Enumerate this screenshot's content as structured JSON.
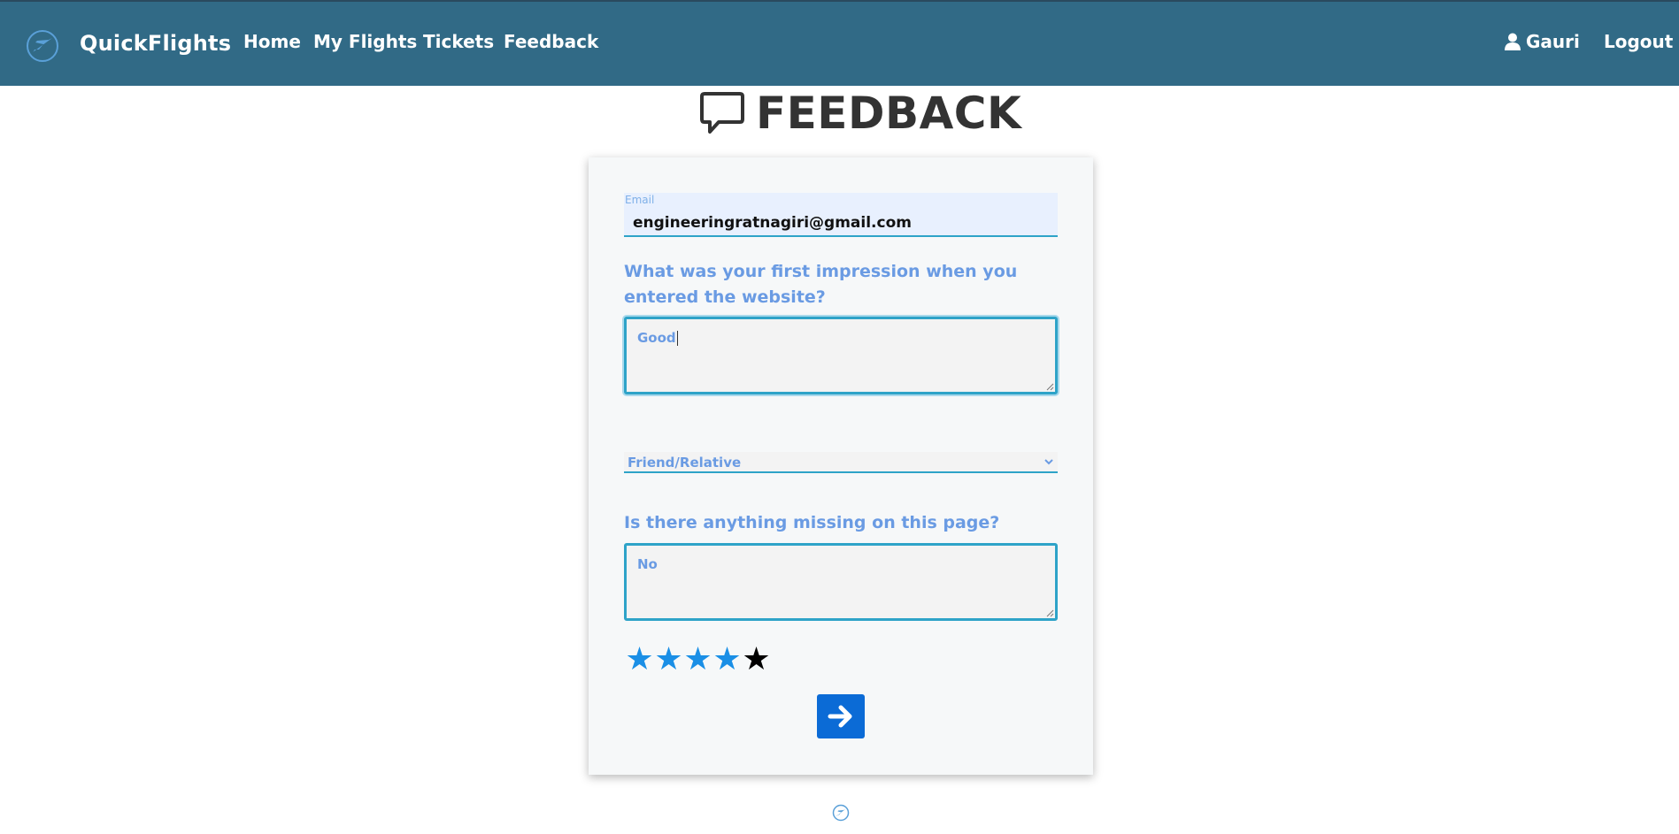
{
  "navbar": {
    "brand": "QuickFlights",
    "links": [
      "Home",
      "My Flights",
      "Tickets",
      "Feedback"
    ],
    "user": "Gauri",
    "logout": "Logout"
  },
  "page": {
    "title": "FEEDBACK"
  },
  "form": {
    "email_label": "Email",
    "email_value": "engineeringratnagiri@gmail.com",
    "question1": "What was your first impression when you entered the website?",
    "answer1": "Good",
    "source_select_value": "Friend/Relative",
    "question2": "Is there anything missing on this page?",
    "answer2": "No",
    "rating": 4,
    "rating_max": 5
  },
  "colors": {
    "navbar": "#316a86",
    "accent": "#2ea3c8",
    "label": "#6a9be3",
    "star_filled": "#1a8fe6",
    "star_empty": "#000000",
    "submit": "#0b6bd6"
  },
  "icons": [
    "plane-logo-icon",
    "user-icon",
    "chat-bubble-icon",
    "chevron-down-icon",
    "star-icon",
    "arrow-right-icon"
  ]
}
